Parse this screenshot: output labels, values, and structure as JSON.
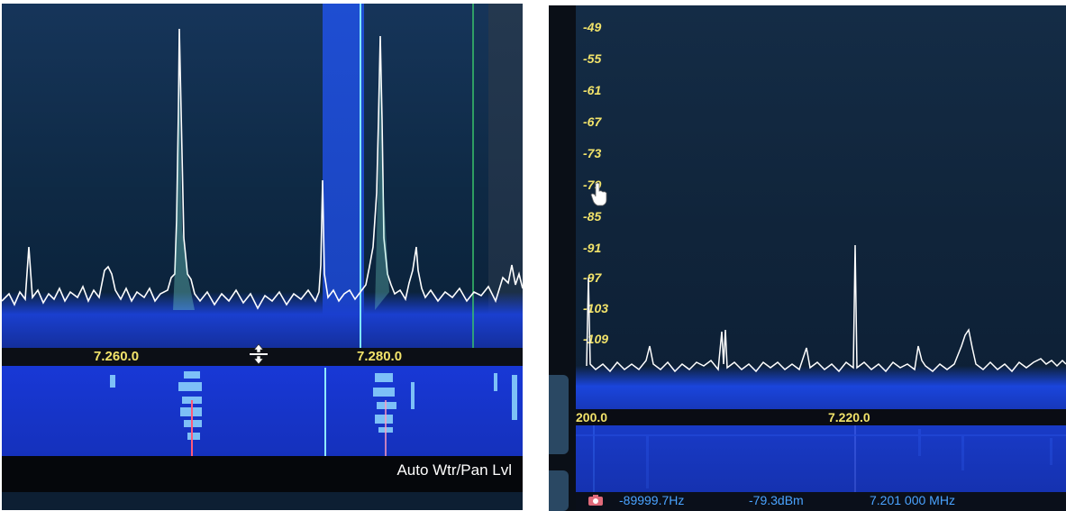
{
  "left_panel": {
    "freq_labels": [
      "7.260.0",
      "7.280.0"
    ],
    "waterfall_mode_label": "Auto Wtr/Pan Lvl",
    "colors": {
      "freq_label": "#f2e36a",
      "trace": "#ffffff",
      "passband": "#1f4fd8"
    },
    "icons": {
      "move": "resize-vertical-icon"
    }
  },
  "right_panel": {
    "db_scale": [
      "-49",
      "-55",
      "-61",
      "-67",
      "-73",
      "-79",
      "-85",
      "-91",
      "-97",
      "-103",
      "-109"
    ],
    "freq_labels": [
      "200.0",
      "7.220.0"
    ],
    "status": {
      "offset": "-89999.7Hz",
      "level": "-79.3dBm",
      "frequency": "7.201 000 MHz"
    },
    "colors": {
      "db_label": "#f2e36a",
      "status_text": "#4aa3ff",
      "trace": "#ffffff"
    },
    "icons": {
      "camera": "camera-icon",
      "cursor": "hand-cursor-icon"
    }
  }
}
